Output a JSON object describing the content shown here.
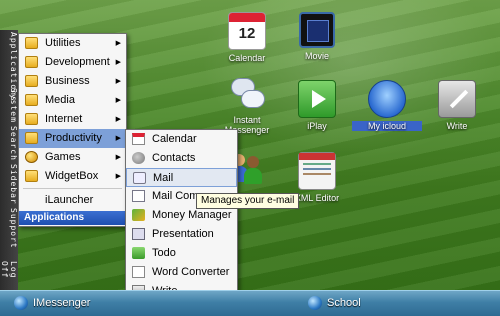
{
  "sidebar_tabs": [
    "Applications",
    "System",
    "Search",
    "Sidebar",
    "Support",
    "Log Off"
  ],
  "apps_menu": {
    "header": "Applications",
    "items": [
      {
        "label": "Utilities",
        "icon": "folder-icon",
        "submenu": true
      },
      {
        "label": "Development",
        "icon": "folder-icon",
        "submenu": true
      },
      {
        "label": "Business",
        "icon": "folder-icon",
        "submenu": true
      },
      {
        "label": "Media",
        "icon": "folder-icon",
        "submenu": true
      },
      {
        "label": "Internet",
        "icon": "folder-icon",
        "submenu": true
      },
      {
        "label": "Productivity",
        "icon": "folder-icon",
        "submenu": true,
        "active": true
      },
      {
        "label": "Games",
        "icon": "games-icon",
        "submenu": true
      },
      {
        "label": "WidgetBox",
        "icon": "folder-icon",
        "submenu": true
      },
      {
        "label": "iLauncher",
        "icon": "blank-icon",
        "submenu": false
      }
    ]
  },
  "productivity_menu": {
    "items": [
      {
        "label": "Calendar",
        "icon": "calendar-icon"
      },
      {
        "label": "Contacts",
        "icon": "contacts-icon"
      },
      {
        "label": "Mail",
        "icon": "mail-icon",
        "active": true
      },
      {
        "label": "Mail Compos",
        "icon": "mail-compose-icon"
      },
      {
        "label": "Money Manager",
        "icon": "money-icon"
      },
      {
        "label": "Presentation",
        "icon": "presentation-icon"
      },
      {
        "label": "Todo",
        "icon": "todo-icon"
      },
      {
        "label": "Word Converter",
        "icon": "word-converter-icon"
      },
      {
        "label": "Write",
        "icon": "write-icon"
      }
    ]
  },
  "tooltip": "Manages your e-mail",
  "desktop_icons": [
    {
      "label": "Calendar",
      "icon": "calendar-icon",
      "badge": "12"
    },
    {
      "label": "Movie",
      "icon": "film-icon"
    },
    {
      "label": "Instant\nMessenger",
      "icon": "messenger-icon"
    },
    {
      "label": "iPlay",
      "icon": "play-icon"
    },
    {
      "label": "My icloud",
      "icon": "cloud-drive-icon",
      "selected": true
    },
    {
      "label": "Write",
      "icon": "write-icon"
    },
    {
      "label": "",
      "icon": "people-icon"
    },
    {
      "label": "XML Editor",
      "icon": "xml-editor-icon"
    }
  ],
  "taskbar": [
    {
      "label": "IMessenger",
      "icon": "globe-icon"
    },
    {
      "label": "School",
      "icon": "globe-icon"
    }
  ],
  "colors": {
    "menu_highlight": "#7da0d8",
    "header_blue": "#1e4fb0",
    "taskbar": "#3f7fa6",
    "grass": "#4e8a2c"
  }
}
